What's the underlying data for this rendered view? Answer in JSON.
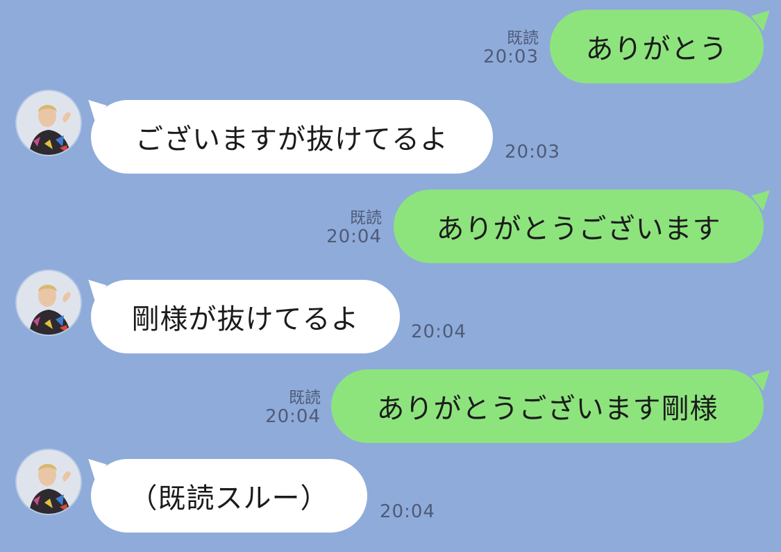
{
  "colors": {
    "background": "#8fabd9",
    "outgoing_bubble": "#8de47d",
    "incoming_bubble": "#ffffff",
    "meta_text": "#4e5b78"
  },
  "messages": [
    {
      "direction": "outgoing",
      "text": "ありがとう",
      "status": "既読",
      "time": "20:03"
    },
    {
      "direction": "incoming",
      "text": "ございますが抜けてるよ",
      "time": "20:03",
      "avatar": "sender-avatar"
    },
    {
      "direction": "outgoing",
      "text": "ありがとうございます",
      "status": "既読",
      "time": "20:04"
    },
    {
      "direction": "incoming",
      "text": "剛様が抜けてるよ",
      "time": "20:04",
      "avatar": "sender-avatar"
    },
    {
      "direction": "outgoing",
      "text": "ありがとうございます剛様",
      "status": "既読",
      "time": "20:04"
    },
    {
      "direction": "incoming",
      "text": "（既読スルー）",
      "time": "20:04",
      "avatar": "sender-avatar"
    }
  ]
}
